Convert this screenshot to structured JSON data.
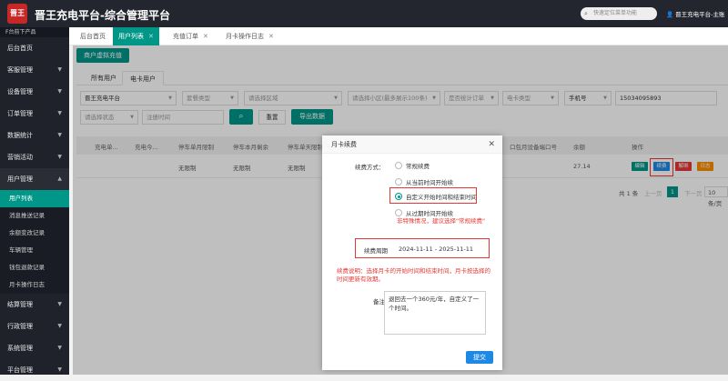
{
  "topbar": {
    "logo_text": "晋王",
    "title": "晋王充电平台-综合管理平台",
    "search_placeholder": "快速定位菜单功能",
    "user": "晋王充电平台-主账"
  },
  "sidebar": {
    "header": "F台前下产品",
    "items": [
      {
        "label": "后台首页"
      },
      {
        "label": "客服管理"
      },
      {
        "label": "设备管理"
      },
      {
        "label": "订单管理"
      },
      {
        "label": "数据统计"
      },
      {
        "label": "营销活动"
      },
      {
        "label": "用户管理"
      }
    ],
    "sub_items": [
      {
        "label": "用户列表"
      },
      {
        "label": "消息推送记录"
      },
      {
        "label": "余额变改记录"
      },
      {
        "label": "车辆管理"
      },
      {
        "label": "钱包退款记录"
      },
      {
        "label": "月卡操作日志"
      }
    ],
    "items2": [
      {
        "label": "结算管理"
      },
      {
        "label": "行政管理"
      },
      {
        "label": "系统管理"
      },
      {
        "label": "平台管理"
      }
    ]
  },
  "tabs": [
    {
      "label": "后台首页"
    },
    {
      "label": "用户列表"
    },
    {
      "label": "充值订单"
    },
    {
      "label": "月卡操作日志"
    }
  ],
  "toolbar": {
    "virtual_recharge": "商户虚拟充值"
  },
  "subtabs": [
    {
      "label": "所有用户"
    },
    {
      "label": "电卡用户"
    }
  ],
  "filters": {
    "platform": "晋王充电平台",
    "package_type": "套餐类型",
    "region": "请选择区域",
    "community": "请选择小区(最多展示100条)",
    "order_stat": "是否统计订单",
    "card_type": "电卡类型",
    "phone_label": "手机号",
    "phone_value": "15034095893",
    "status": "请选择状态",
    "register_time": "注册时间",
    "reset": "重置",
    "export": "导出数据"
  },
  "table": {
    "headers": [
      "充电单...",
      "充电今...",
      "停车单月限制",
      "停车本月剩余",
      "停车单天限制",
      "口包月设备端口号",
      "余额",
      "操作"
    ],
    "row": {
      "c1": "无限制",
      "c2": "无限制",
      "c3": "无限制",
      "balance": "27.14"
    },
    "actions": [
      "编辑",
      "续费",
      "解绑",
      "日志"
    ]
  },
  "pager": {
    "total": "共 1 条",
    "prev": "上一页",
    "page": "1",
    "next": "下一页",
    "size": "10 条/页"
  },
  "modal": {
    "title": "月卡续费",
    "renew_mode_label": "续费方式：",
    "options": [
      "常规续费",
      "从当前时间开始续",
      "自定义开始时间和结束时间",
      "从过期时间开始续"
    ],
    "selected_index": 2,
    "special_note": "非特殊情况，建议选择\"常规续费\"",
    "period_label": "续费周期",
    "period_value": "2024-11-11 - 2025-11-11",
    "description": "续费说明：选择月卡的开始时间和结束时间，月卡按选择的时间更新有效期。",
    "remark_label": "备注",
    "remark_value": "退回去一个360元/年，自定义了一个时间。",
    "submit": "提交"
  }
}
